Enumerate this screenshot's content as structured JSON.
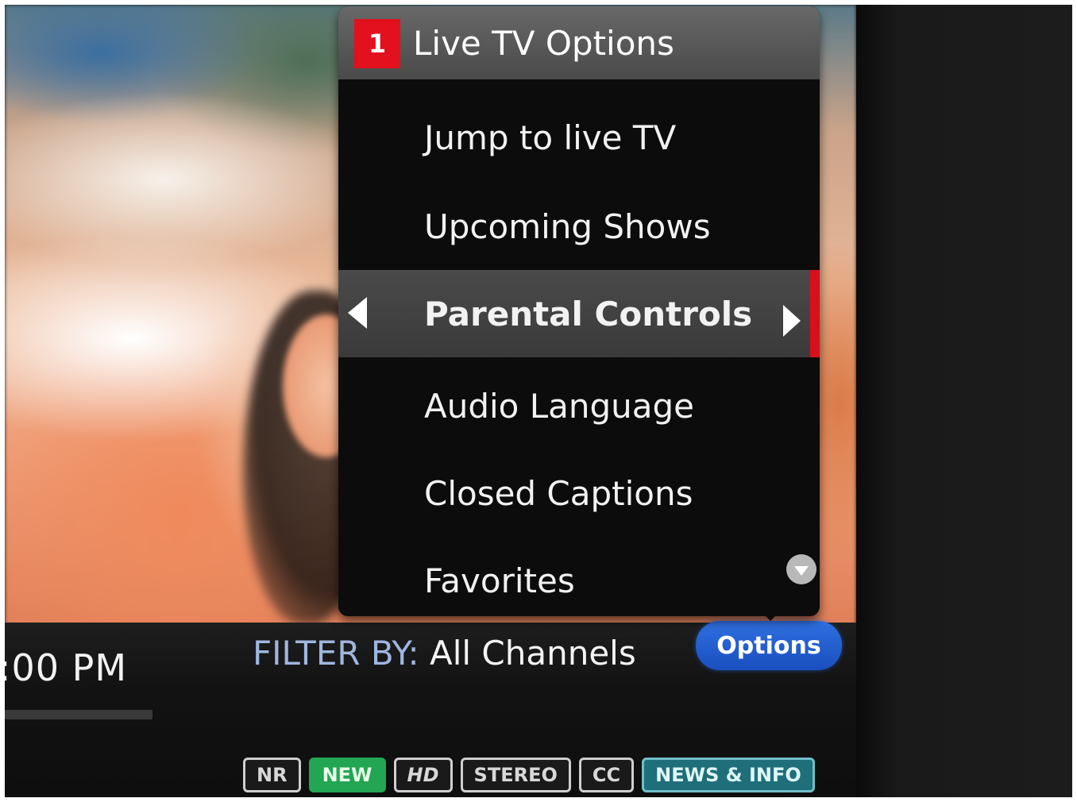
{
  "menu": {
    "step": "1",
    "title": "Live TV Options",
    "items": [
      {
        "label": "Jump to live TV",
        "selected": false
      },
      {
        "label": "Upcoming Shows",
        "selected": false
      },
      {
        "label": "Parental Controls",
        "selected": true
      },
      {
        "label": "Audio Language",
        "selected": false
      },
      {
        "label": "Closed Captions",
        "selected": false
      },
      {
        "label": "Favorites",
        "selected": false
      }
    ]
  },
  "guide": {
    "time": ":00 PM",
    "filter_label": "FILTER BY:",
    "filter_value": "All Channels",
    "options_button": "Options",
    "badges": [
      "NR",
      "NEW",
      "HD",
      "STEREO",
      "CC",
      "NEWS & INFO"
    ]
  },
  "colors": {
    "accent_red": "#e3101e",
    "options_blue": "#1a4fbf",
    "new_badge_green": "#23a653",
    "news_badge_teal": "#1f6f7a"
  }
}
